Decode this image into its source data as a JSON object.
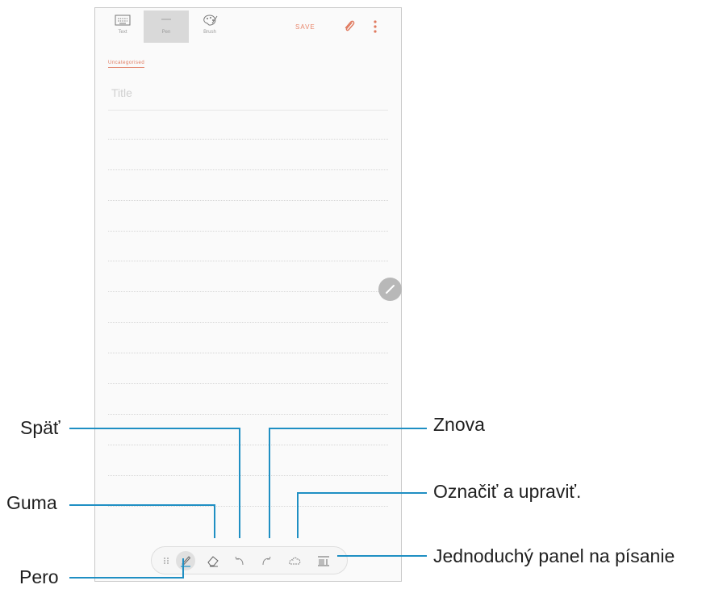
{
  "app": {
    "mode_tabs": [
      {
        "label": "Text",
        "icon": "keyboard-icon"
      },
      {
        "label": "Pen",
        "icon": "pen-mode-icon"
      },
      {
        "label": "Brush",
        "icon": "palette-icon"
      }
    ],
    "save_label": "SAVE",
    "category_label": "Uncategorised",
    "title_placeholder": "Title",
    "edit_icon": "pencil-icon",
    "accent_color": "#e07a5f",
    "toolbar_icons": [
      "drag-handle-icon",
      "pen-icon",
      "eraser-icon",
      "undo-icon",
      "redo-icon",
      "selection-lasso-icon",
      "easy-writing-pad-icon"
    ]
  },
  "callouts": {
    "undo": "Späť",
    "redo": "Znova",
    "eraser": "Guma",
    "select": "Označiť a upraviť.",
    "pen": "Pero",
    "writing_pad": "Jednoduchý panel na písanie"
  },
  "callout_line_color": "#1f8fc3"
}
